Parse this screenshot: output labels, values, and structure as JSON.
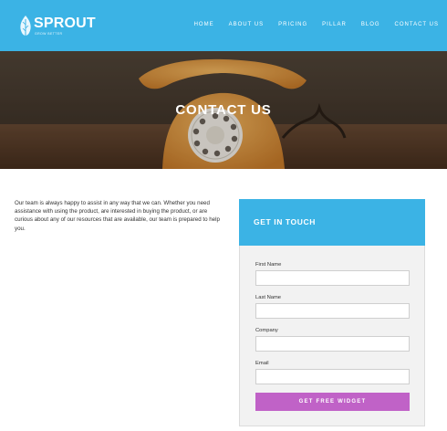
{
  "brand": {
    "name": "SPROUT",
    "tagline": "GROW BETTER",
    "color": "#3bb3e5"
  },
  "nav": {
    "items": [
      "HOME",
      "ABOUT US",
      "PRICING",
      "PILLAR",
      "BLOG",
      "CONTACT US"
    ]
  },
  "hero": {
    "title": "CONTACT US"
  },
  "intro": {
    "text": "Our team is always happy to assist in any way that we can. Whether you need assistance with using the product, are interested in buying the product, or are curious about any of our resources that are available, our team is prepared to help you."
  },
  "form": {
    "title": "GET IN TOUCH",
    "fields": [
      {
        "label": "First Name",
        "value": ""
      },
      {
        "label": "Last Name",
        "value": ""
      },
      {
        "label": "Company",
        "value": ""
      },
      {
        "label": "Email",
        "value": ""
      }
    ],
    "submit_label": "GET FREE WIDGET",
    "submit_color": "#c062c7"
  }
}
